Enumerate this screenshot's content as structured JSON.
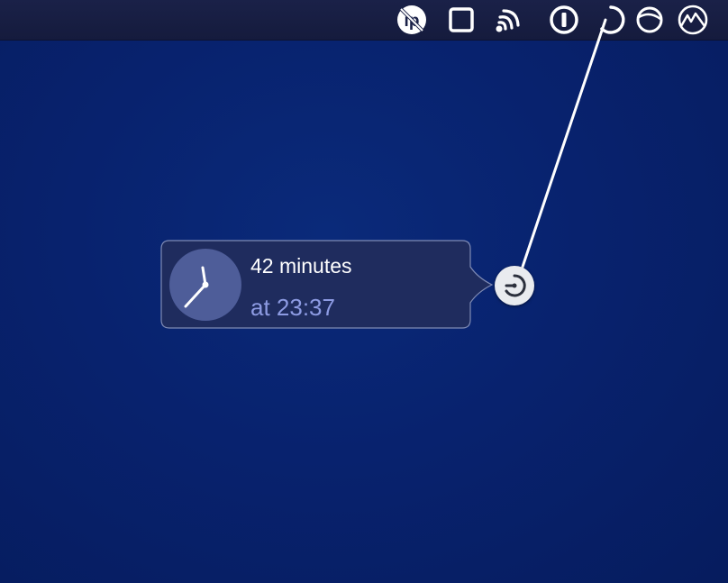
{
  "menubar": {
    "icons": [
      {
        "name": "no-tracking-icon"
      },
      {
        "name": "square-stop-icon"
      },
      {
        "name": "signal-beam-icon"
      },
      {
        "name": "password-manager-icon"
      },
      {
        "name": "timer-icon"
      },
      {
        "name": "half-circle-icon"
      },
      {
        "name": "mountain-icon"
      }
    ]
  },
  "timer_popover": {
    "duration_text": "42 minutes",
    "eta_text": "at 23:37"
  },
  "colors": {
    "desktop": "#08226e",
    "menubar": "#171d42",
    "popover_bg": "#1f2c5e",
    "clock_face": "#4e5d99",
    "eta_text": "#8d9be3"
  }
}
